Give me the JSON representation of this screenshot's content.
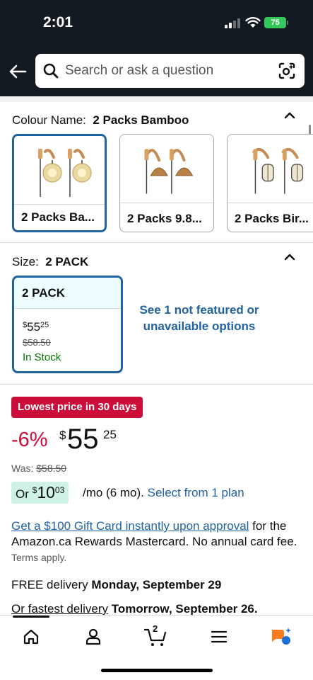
{
  "status_bar": {
    "time": "2:01",
    "battery": "75"
  },
  "header": {
    "search_placeholder": "Search or ask a question"
  },
  "colour": {
    "label": "Colour Name:",
    "selected": "2 Packs Bamboo",
    "options": [
      {
        "label": "2 Packs Ba...",
        "selected": true
      },
      {
        "label": "2 Packs 9.8...",
        "selected": false
      },
      {
        "label": "2 Packs Bir...",
        "selected": false
      }
    ]
  },
  "size": {
    "label": "Size:",
    "selected": "2 PACK",
    "card": {
      "title": "2 PACK",
      "price_symbol": "$",
      "price_whole": "55",
      "price_fraction": "25",
      "was": "$58.50",
      "stock": "In Stock"
    },
    "see_more": "See 1 not featured or unavailable options"
  },
  "price": {
    "badge": "Lowest price in 30 days",
    "discount": "-6%",
    "symbol": "$",
    "whole": "55",
    "fraction": "25",
    "was_label": "Was:",
    "was_value": "$58.50"
  },
  "monthly": {
    "prefix": "Or",
    "symbol": "$",
    "whole": "10",
    "fraction": "03",
    "term": "/mo (6 mo).",
    "link": "Select from 1 plan"
  },
  "gift": {
    "link": "Get a $100 Gift Card instantly upon approval",
    "text": " for the Amazon.ca Rewards Mastercard. No annual card fee.",
    "terms": "Terms apply."
  },
  "delivery": {
    "prefix": "FREE delivery",
    "date": "Monday, September 29",
    "fast_prefix": "Or fastest delivery",
    "fast_date": "Tomorrow, September 26."
  },
  "nav": {
    "cart_count": "2",
    "items": [
      "home-icon",
      "account-icon",
      "cart-icon",
      "menu-icon",
      "rufus-icon"
    ]
  },
  "colors": {
    "header_bg": "#131a22",
    "link": "#2162a1",
    "deal_red": "#cc0c39",
    "stock_green": "#007600",
    "battery_green": "#34c759",
    "monthly_bg": "#cff2e8"
  }
}
